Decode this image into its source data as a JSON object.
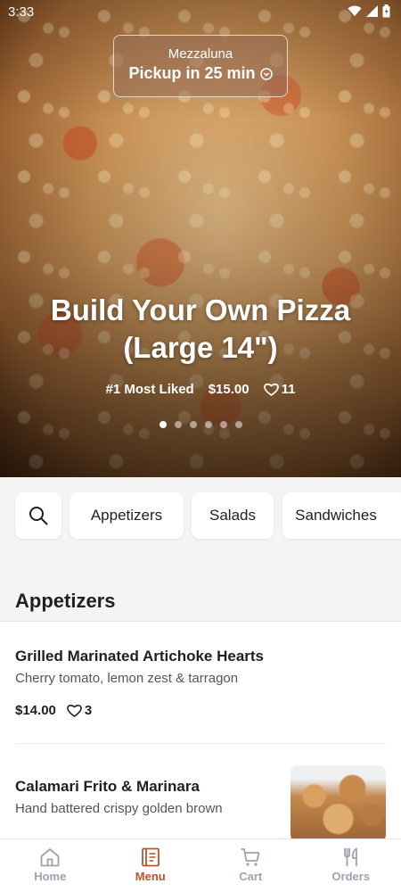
{
  "status_bar": {
    "time": "3:33"
  },
  "restaurant": {
    "name": "Mezzaluna",
    "pickup": "Pickup in 25 min"
  },
  "hero": {
    "title_line1": "Build Your Own Pizza",
    "title_line2": "(Large 14\")",
    "rank": "#1 Most Liked",
    "price": "$15.00",
    "likes": "11",
    "carousel": {
      "count": 6,
      "active_index": 0
    }
  },
  "categories": [
    "Appetizers",
    "Salads",
    "Sandwiches"
  ],
  "section": {
    "title": "Appetizers"
  },
  "items": [
    {
      "name": "Grilled Marinated Artichoke Hearts",
      "description": "Cherry tomato, lemon zest & tarragon",
      "price": "$14.00",
      "likes": "3"
    },
    {
      "name": "Calamari Frito & Marinara",
      "description": "Hand battered crispy golden brown"
    }
  ],
  "nav": [
    {
      "label": "Home",
      "icon": "home-icon"
    },
    {
      "label": "Menu",
      "icon": "menu-book-icon",
      "active": true
    },
    {
      "label": "Cart",
      "icon": "cart-icon"
    },
    {
      "label": "Orders",
      "icon": "fork-knife-icon"
    }
  ],
  "colors": {
    "accent": "#b9532a",
    "inactive": "#9ca3af",
    "background": "#f4f4f5"
  }
}
